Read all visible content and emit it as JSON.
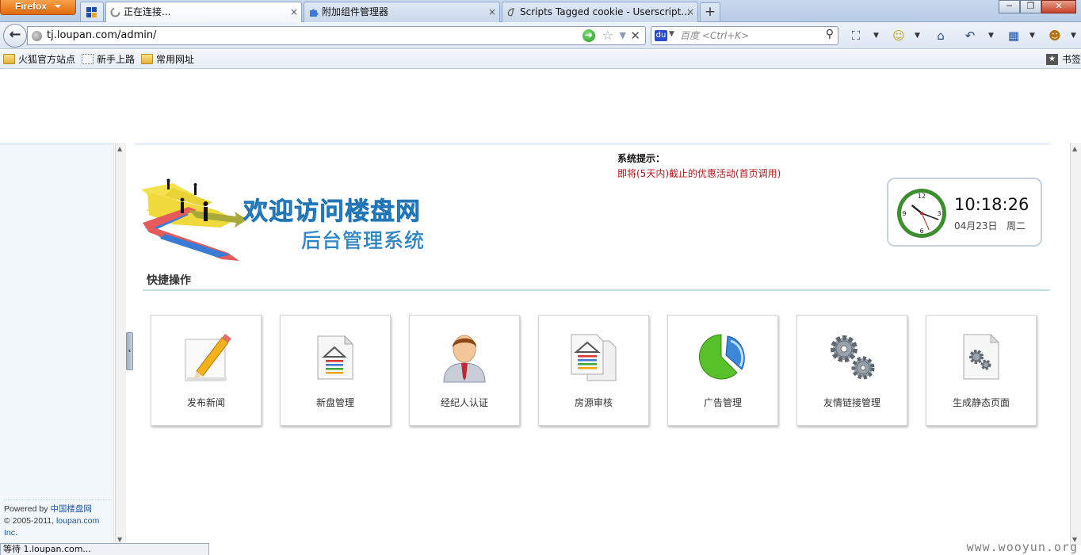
{
  "browser": {
    "menu_label": "Firefox",
    "tabs": [
      {
        "title": "正在连接...",
        "active": true
      },
      {
        "title": "附加组件管理器",
        "active": false
      },
      {
        "title": "Scripts Tagged cookie - Userscript...",
        "active": false
      }
    ],
    "new_tab_label": "+",
    "close_glyph": "×",
    "url": "tj.loupan.com/admin/",
    "search_placeholder": "百度 <Ctrl+K>",
    "bookmarks": [
      {
        "label": "火狐官方站点",
        "icon": "folder-icon"
      },
      {
        "label": "新手上路",
        "icon": "dotted-page-icon"
      },
      {
        "label": "常用网址",
        "icon": "folder-icon"
      }
    ],
    "bookmarks_right_label": "书签",
    "status_text": "等待 1.loupan.com...",
    "accent_color": "#e06a0b"
  },
  "sidebar": {
    "powered_by_prefix": "Powered by ",
    "powered_by_link": "中国楼盘网",
    "copyright_prefix": "© 2005-2011, ",
    "copyright_link": "loupan.com",
    "copyright_suffix": "Inc.",
    "collapse_glyph": "‹"
  },
  "header": {
    "notice_title": "系统提示：",
    "notice_item": "即将(5天内)截止的优惠活动(首页调用)",
    "logo_line1": "欢迎访问楼盘网",
    "logo_line2": "后台管理系统",
    "clock": {
      "time": "10:18:26",
      "date": "04月23日",
      "weekday": "周二",
      "hour": 10,
      "minute": 18,
      "second": 26,
      "dial_labels": [
        "12",
        "3",
        "6",
        "9"
      ]
    }
  },
  "quick_actions": {
    "title": "快捷操作",
    "items": [
      {
        "label": "发布新闻",
        "icon": "pencil-note-icon"
      },
      {
        "label": "新盘管理",
        "icon": "house-document-icon"
      },
      {
        "label": "经纪人认证",
        "icon": "person-icon"
      },
      {
        "label": "房源审核",
        "icon": "house-documents-icon"
      },
      {
        "label": "广告管理",
        "icon": "pie-chart-icon"
      },
      {
        "label": "友情链接管理",
        "icon": "gears-icon"
      },
      {
        "label": "生成静态页面",
        "icon": "gear-document-icon"
      }
    ]
  },
  "watermark": "www.wooyun.org"
}
